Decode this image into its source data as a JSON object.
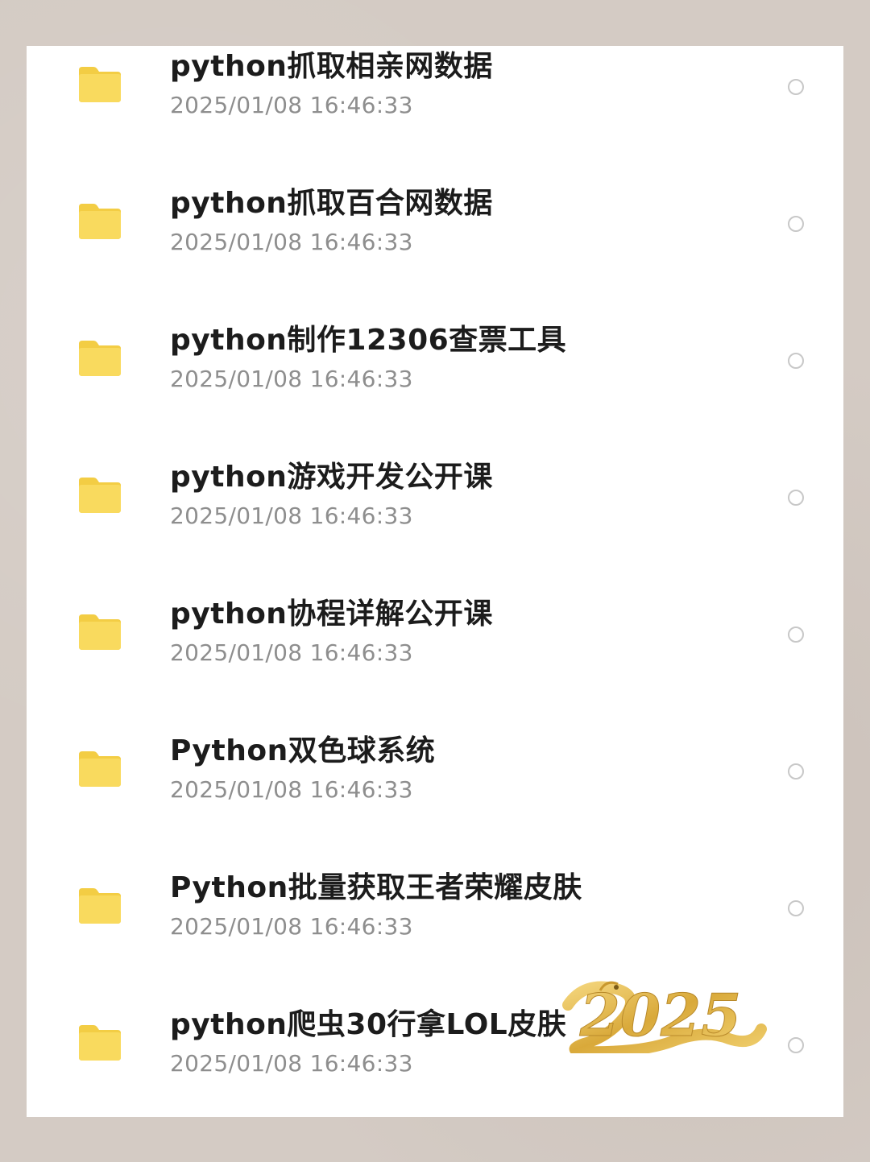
{
  "files": [
    {
      "name": "python抓取相亲网数据",
      "date": "2025/01/08 16:46:33",
      "icon": "folder-icon"
    },
    {
      "name": "python抓取百合网数据",
      "date": "2025/01/08 16:46:33",
      "icon": "folder-icon"
    },
    {
      "name": "python制作12306查票工具",
      "date": "2025/01/08 16:46:33",
      "icon": "folder-icon"
    },
    {
      "name": "python游戏开发公开课",
      "date": "2025/01/08 16:46:33",
      "icon": "folder-icon"
    },
    {
      "name": "python协程详解公开课",
      "date": "2025/01/08 16:46:33",
      "icon": "folder-icon"
    },
    {
      "name": "Python双色球系统",
      "date": "2025/01/08 16:46:33",
      "icon": "folder-icon"
    },
    {
      "name": "Python批量获取王者荣耀皮肤",
      "date": "2025/01/08 16:46:33",
      "icon": "folder-icon"
    },
    {
      "name": "python爬虫30行拿LOL皮肤",
      "date": "2025/01/08 16:46:33",
      "icon": "folder-icon"
    }
  ],
  "colors": {
    "folder": "#f8d85a",
    "folder_tab": "#f3cd44",
    "sticker_gold": "#e2b84a"
  },
  "sticker": {
    "text": "2025"
  }
}
